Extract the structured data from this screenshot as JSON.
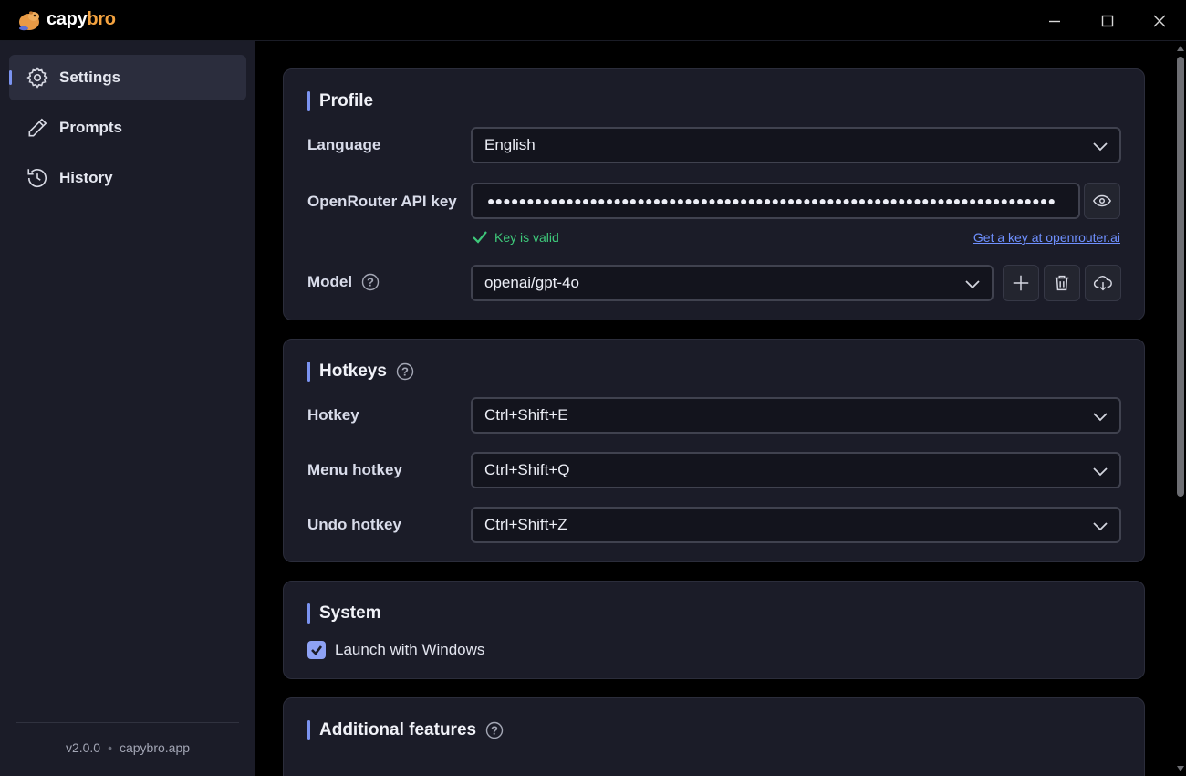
{
  "app": {
    "logo_text_a": "capy",
    "logo_text_b": "bro"
  },
  "window_controls": {
    "minimize_icon": "minimize-icon",
    "maximize_icon": "maximize-icon",
    "close_icon": "close-icon"
  },
  "sidebar": {
    "items": [
      {
        "label": "Settings",
        "icon": "gear-icon",
        "active": true
      },
      {
        "label": "Prompts",
        "icon": "pen-icon",
        "active": false
      },
      {
        "label": "History",
        "icon": "history-icon",
        "active": false
      }
    ],
    "footer": {
      "version": "v2.0.0",
      "separator": "•",
      "site": "capybro.app"
    }
  },
  "profile": {
    "title": "Profile",
    "language_label": "Language",
    "language_value": "English",
    "api_key_label": "OpenRouter API key",
    "api_key_masked": "●●●●●●●●●●●●●●●●●●●●●●●●●●●●●●●●●●●●●●●●●●●●●●●●●●●●●●●●●●●●●●●●●●●●●●●●",
    "key_status": "Key is valid",
    "get_key_link": "Get a key at openrouter.ai",
    "model_label": "Model",
    "model_value": "openai/gpt-4o"
  },
  "hotkeys": {
    "title": "Hotkeys",
    "hotkey_label": "Hotkey",
    "hotkey_value": "Ctrl+Shift+E",
    "menu_hotkey_label": "Menu hotkey",
    "menu_hotkey_value": "Ctrl+Shift+Q",
    "undo_hotkey_label": "Undo hotkey",
    "undo_hotkey_value": "Ctrl+Shift+Z"
  },
  "system": {
    "title": "System",
    "launch_label": "Launch with Windows",
    "launch_checked": true
  },
  "additional": {
    "title": "Additional features"
  },
  "help_glyph": "?",
  "colors": {
    "accent": "#7b93f0",
    "valid_green": "#3ec87a",
    "link_blue": "#6f90ff",
    "sidebar_bg": "#1b1c28",
    "card_bg": "#1b1c28"
  }
}
